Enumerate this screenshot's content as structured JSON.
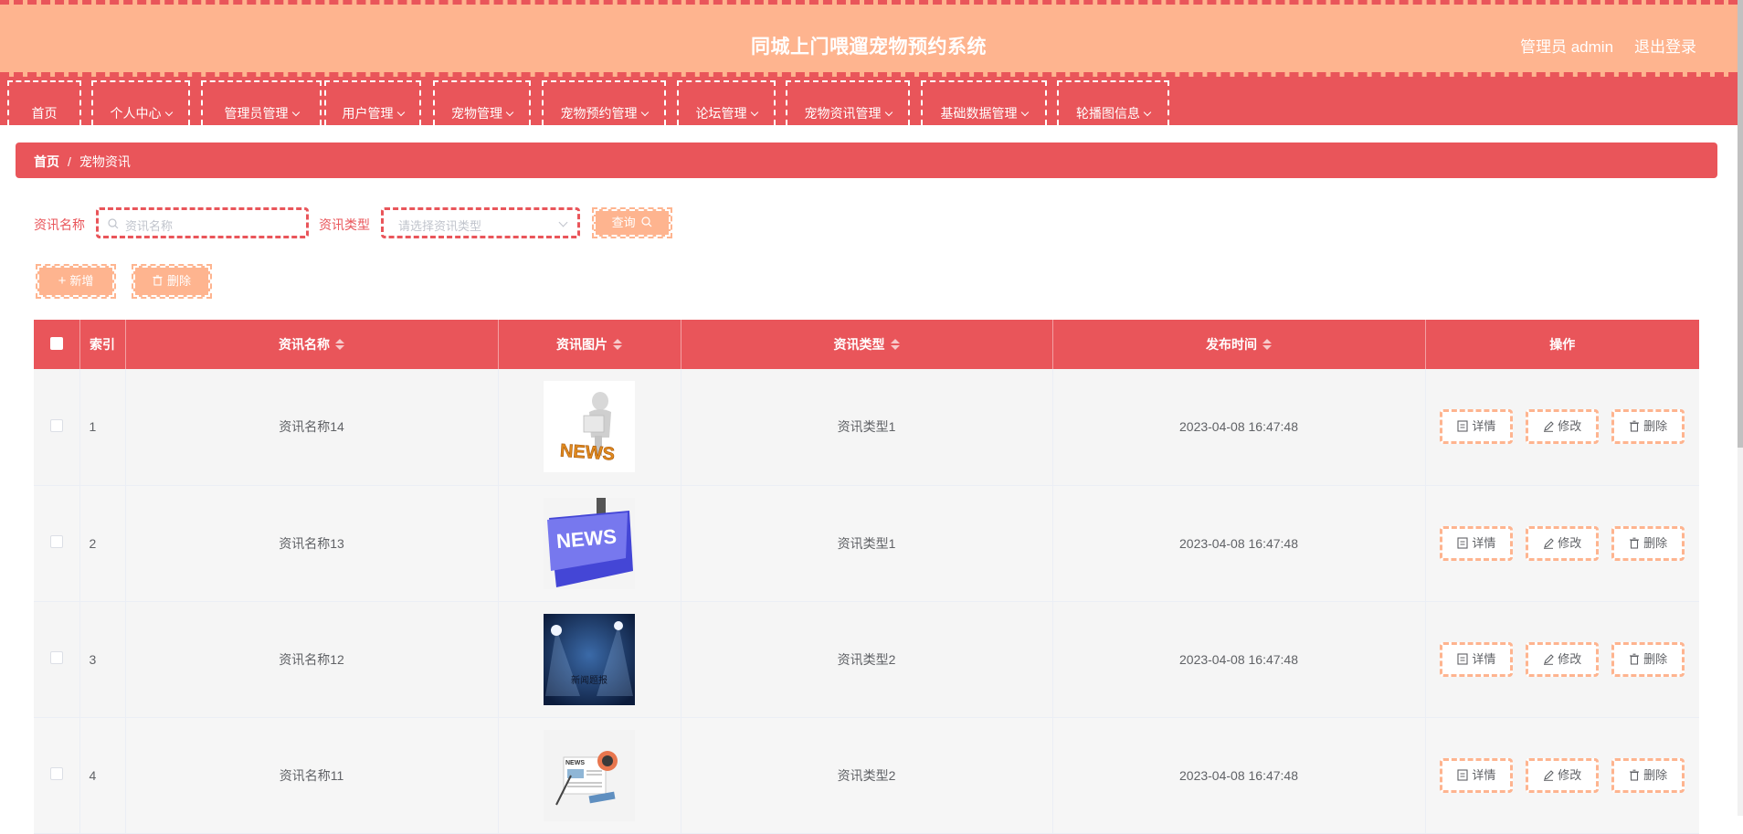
{
  "header": {
    "title": "同城上门喂遛宠物预约系统",
    "admin_label": "管理员 admin",
    "logout_label": "退出登录"
  },
  "nav": {
    "items": [
      {
        "label": "首页",
        "dropdown": false
      },
      {
        "label": "个人中心",
        "dropdown": true
      },
      {
        "label": "管理员管理",
        "dropdown": true
      },
      {
        "label": "用户管理",
        "dropdown": true
      },
      {
        "label": "宠物管理",
        "dropdown": true
      },
      {
        "label": "宠物预约管理",
        "dropdown": true
      },
      {
        "label": "论坛管理",
        "dropdown": true
      },
      {
        "label": "宠物资讯管理",
        "dropdown": true
      },
      {
        "label": "基础数据管理",
        "dropdown": true
      },
      {
        "label": "轮播图信息",
        "dropdown": true
      }
    ]
  },
  "breadcrumb": {
    "home": "首页",
    "separator": "/",
    "current": "宠物资讯"
  },
  "search": {
    "name_label": "资讯名称",
    "name_placeholder": "资讯名称",
    "type_label": "资讯类型",
    "type_placeholder": "请选择资讯类型",
    "query_button": "查询"
  },
  "actions": {
    "add_button": "新增",
    "delete_button": "删除"
  },
  "table": {
    "columns": [
      "索引",
      "资讯名称",
      "资讯图片",
      "资讯类型",
      "发布时间",
      "操作"
    ],
    "rows": [
      {
        "index": "1",
        "name": "资讯名称14",
        "image": "news-figure-image",
        "type": "资讯类型1",
        "time": "2023-04-08 16:47:48"
      },
      {
        "index": "2",
        "name": "资讯名称13",
        "image": "news-key-image",
        "type": "资讯类型1",
        "time": "2023-04-08 16:47:48"
      },
      {
        "index": "3",
        "name": "资讯名称12",
        "image": "news-stage-image",
        "type": "资讯类型2",
        "time": "2023-04-08 16:47:48"
      },
      {
        "index": "4",
        "name": "资讯名称11",
        "image": "news-paper-image",
        "type": "资讯类型2",
        "time": "2023-04-08 16:47:48"
      }
    ],
    "row_actions": {
      "detail": "详情",
      "edit": "修改",
      "delete": "删除"
    },
    "image_texts": {
      "news": "NEWS",
      "stage": "新闻题报"
    }
  },
  "colors": {
    "primary": "#e9555a",
    "accent": "#feb48f",
    "text": "#606266"
  }
}
